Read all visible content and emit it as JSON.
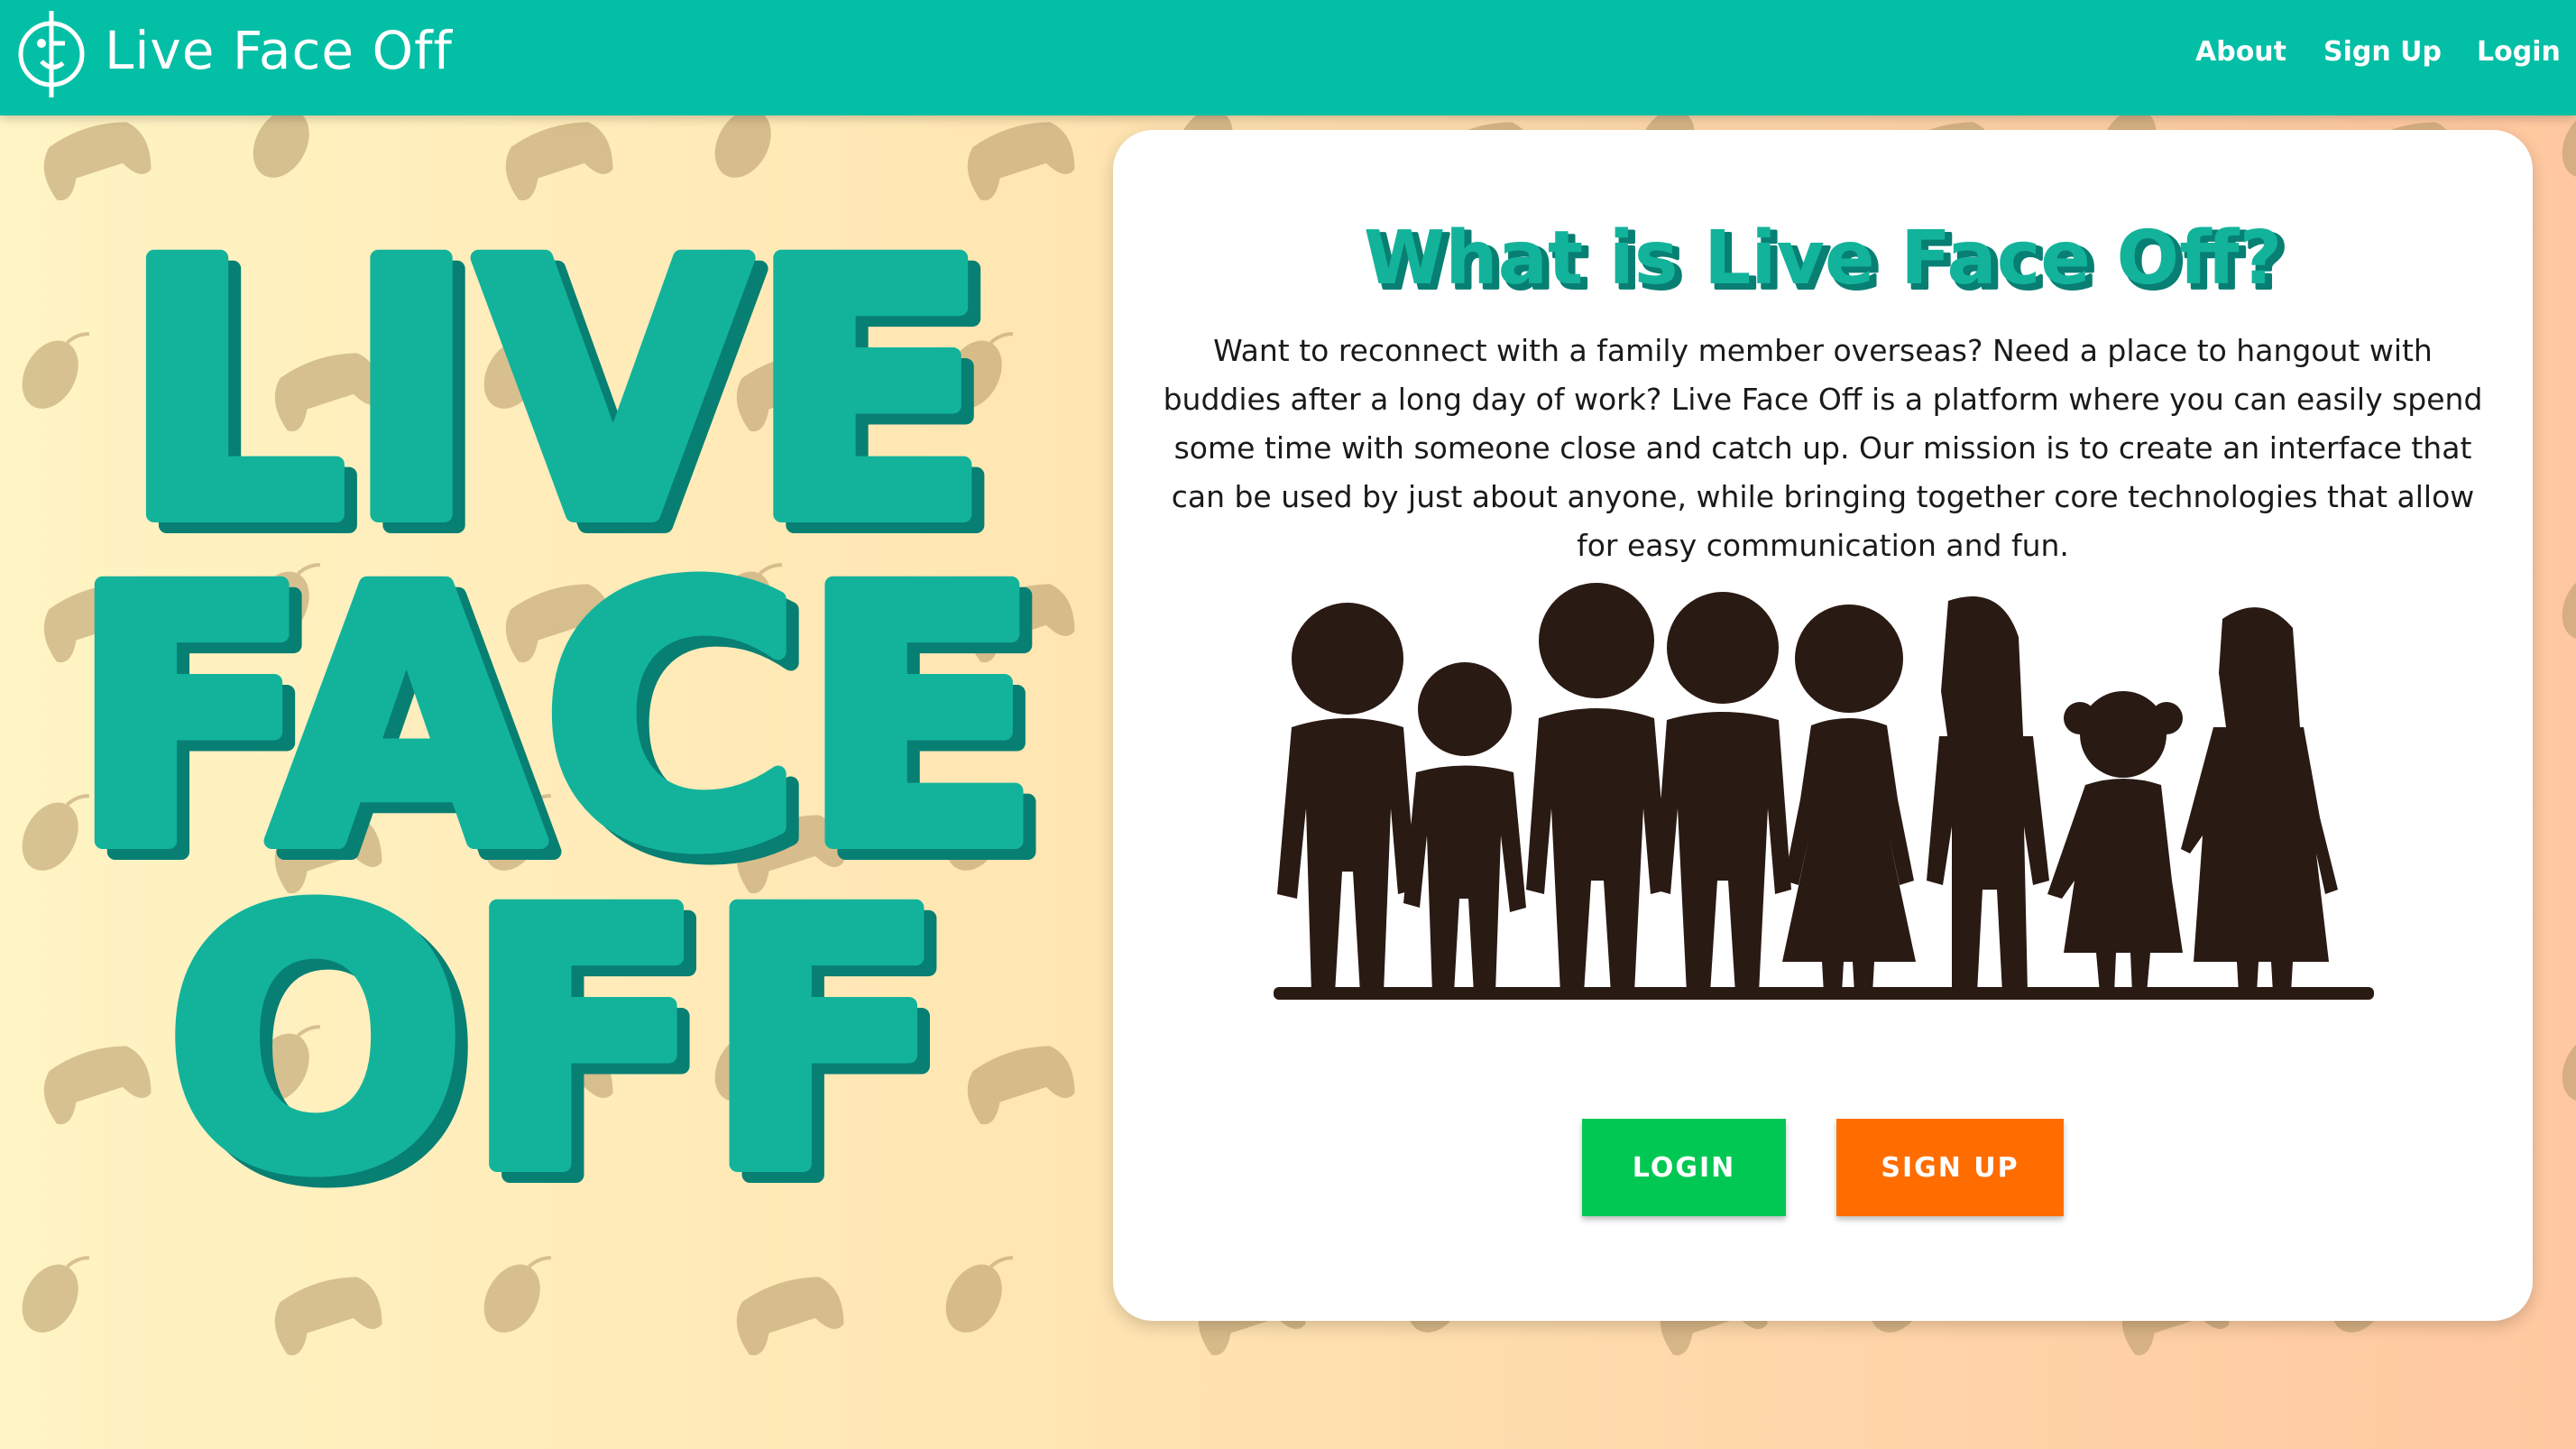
{
  "colors": {
    "navbar": "#03bfa6",
    "accent_teal": "#13b39b",
    "teal_shadow": "#087f73",
    "login_button": "#00c853",
    "signup_button": "#ff6d00",
    "silhouette": "#2a1a14"
  },
  "navbar": {
    "logo_icon": "smiley-face-logo-icon",
    "brand": "Live Face Off",
    "links": [
      {
        "label": "About"
      },
      {
        "label": "Sign Up"
      },
      {
        "label": "Login"
      }
    ]
  },
  "hero": {
    "lines": [
      "LIVE",
      "FACE",
      "OFF"
    ]
  },
  "background_pattern": [
    "gamepad-icon",
    "mouse-icon"
  ],
  "card": {
    "title": "What is Live Face Off?",
    "description": "Want to reconnect with a family member overseas? Need a place to hangout with buddies after a long day of work? Live Face Off is a platform where you can easily spend some time with someone close and catch up. Our mission is to create an interface that can be used by just about anyone, while bringing together core technologies that allow for easy communication and fun.",
    "illustration": "family-silhouette-image",
    "login_label": "LOGIN",
    "signup_label": "SIGN UP"
  }
}
